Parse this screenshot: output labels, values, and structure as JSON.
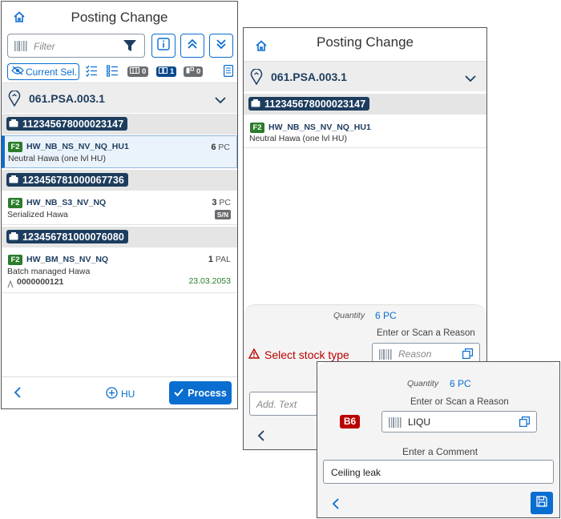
{
  "app": {
    "title": "Posting Change"
  },
  "filter": {
    "placeholder": "Filter"
  },
  "toolbar": {
    "current_sel": "Current Sel.",
    "chip_counts": [
      "0",
      "1",
      "0"
    ]
  },
  "storage_bin": "061.PSA.003.1",
  "screen1": {
    "groups": [
      {
        "hu": "112345678000023147",
        "items": [
          {
            "badge": "F2",
            "product": "HW_NB_NS_NV_NQ_HU1",
            "desc": "Neutral Hawa (one lvl HU)",
            "qty": "6",
            "uom": "PC"
          }
        ]
      },
      {
        "hu": "123456781000067736",
        "items": [
          {
            "badge": "F2",
            "product": "HW_NB_S3_NV_NQ",
            "desc": "Serialized Hawa",
            "qty": "3",
            "uom": "PC",
            "tag": "S/N"
          }
        ]
      },
      {
        "hu": "123456781000076080",
        "items": [
          {
            "badge": "F2",
            "product": "HW_BM_NS_NV_NQ",
            "desc": "Batch managed Hawa",
            "qty": "1",
            "uom": "PAL",
            "batch": "0000000121",
            "date": "23.03.2053"
          }
        ]
      }
    ],
    "footer": {
      "hu_label": "HU",
      "process_label": "Process"
    }
  },
  "screen2": {
    "hu": "112345678000023147",
    "item": {
      "badge": "F2",
      "product": "HW_NB_NS_NV_NQ_HU1",
      "desc": "Neutral Hawa (one lvl HU)"
    },
    "quantity_label": "Quantity",
    "quantity_value": "6 PC",
    "reason_label": "Enter or Scan a Reason",
    "warning": "Select stock type",
    "reason_placeholder": "Reason",
    "addtext_placeholder": "Add. Text"
  },
  "screen3": {
    "quantity_label": "Quantity",
    "quantity_value": "6 PC",
    "reason_label": "Enter or Scan a Reason",
    "stock_badge": "B6",
    "reason_value": "LIQU",
    "comment_label": "Enter a Comment",
    "comment_value": "Ceiling leak"
  },
  "colors": {
    "accent": "#0a6ed1",
    "hu_tag": "#1d3d5e",
    "badge_f2": "#2b7d2b",
    "error": "#bb0000"
  },
  "icons": [
    "home-icon",
    "barcode-icon",
    "funnel-icon",
    "info-icon",
    "double-chevron-up-icon",
    "double-chevron-down-icon",
    "eye-off-icon",
    "checklist-icon",
    "list-icon",
    "pin-icon",
    "chevron-down-icon",
    "hu-icon",
    "back-icon",
    "add-circle-icon",
    "check-icon",
    "warning-icon",
    "copy-icon",
    "save-icon"
  ]
}
